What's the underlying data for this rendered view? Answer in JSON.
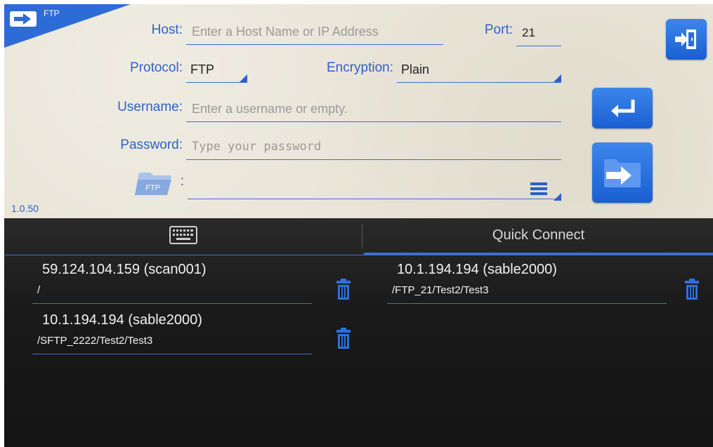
{
  "app": {
    "badge_label": "FTP",
    "version": "1.0.50",
    "accent_color": "#2e62c7",
    "button_color": "#2a6fe0"
  },
  "form": {
    "host": {
      "label": "Host:",
      "placeholder": "Enter a Host Name or IP Address"
    },
    "port": {
      "label": "Port:",
      "value": "21"
    },
    "protocol": {
      "label": "Protocol:",
      "value": "FTP"
    },
    "encryption": {
      "label": "Encryption:",
      "value": "Plain"
    },
    "username": {
      "label": "Username:",
      "placeholder": "Enter a username or empty."
    },
    "password": {
      "label": "Password:",
      "placeholder": "Type your password"
    },
    "folder": {
      "icon_label": "FTP",
      "colon": ":",
      "value": ""
    }
  },
  "buttons": {
    "exit": "exit-icon",
    "enter": "enter-return-icon",
    "connect": "folder-connect-icon"
  },
  "tabs": {
    "keyboard_icon": "keyboard-icon",
    "quick_connect": "Quick Connect"
  },
  "connections": [
    {
      "title": "59.124.104.159 (scan001)",
      "path": "/"
    },
    {
      "title": "10.1.194.194 (sable2000)",
      "path": "/SFTP_2222/Test2/Test3"
    },
    {
      "title": "10.1.194.194 (sable2000)",
      "path": "/FTP_21/Test2/Test3"
    }
  ]
}
